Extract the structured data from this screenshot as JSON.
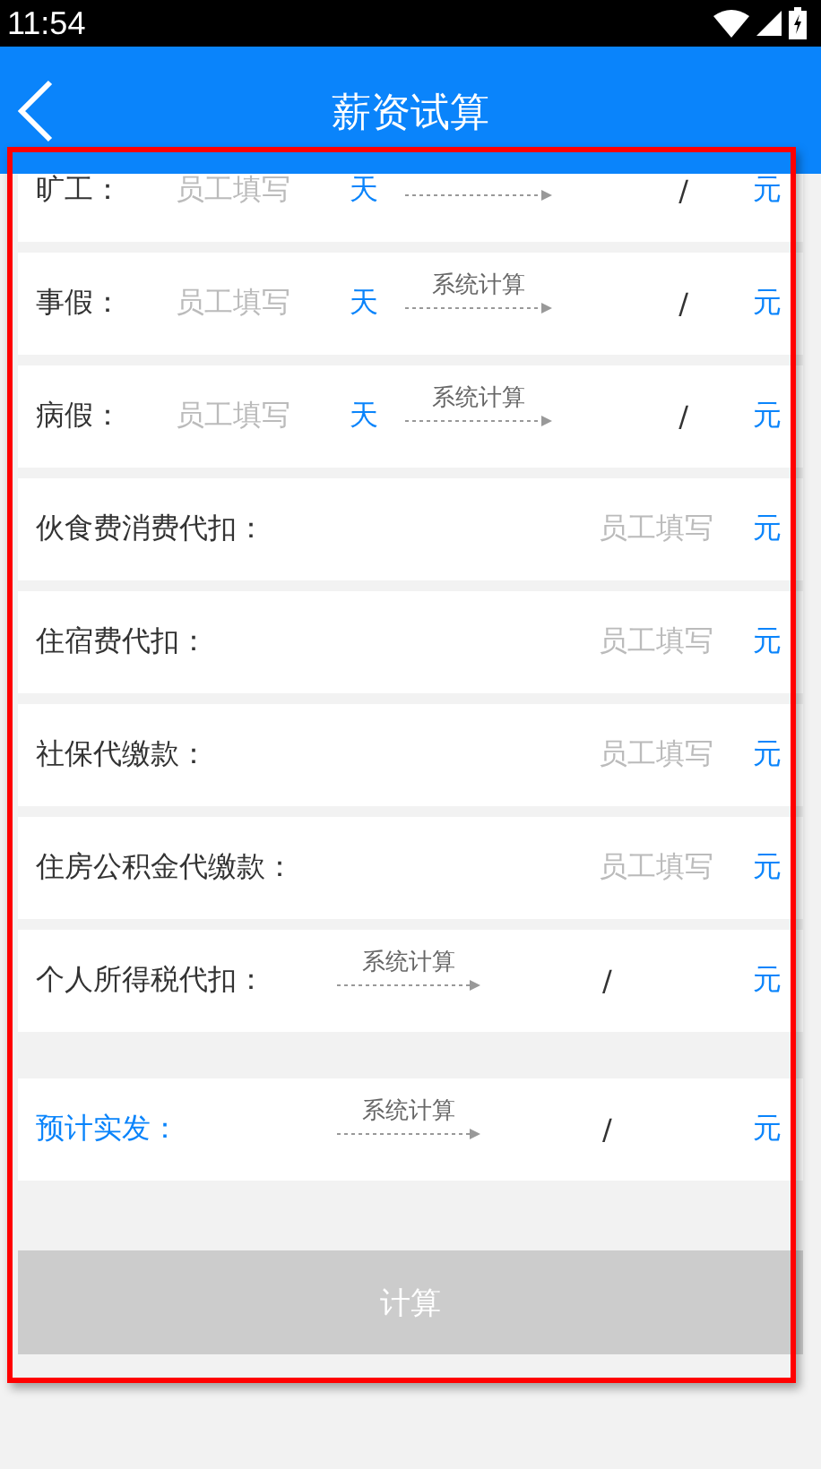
{
  "status_bar": {
    "time": "11:54"
  },
  "app_bar": {
    "title": "薪资试算"
  },
  "rows": [
    {
      "kind": "days",
      "label": "旷工：",
      "placeholder": "员工填写",
      "unit": "天",
      "value": "/",
      "currency": "元"
    },
    {
      "kind": "days",
      "label": "事假：",
      "placeholder": "员工填写",
      "unit": "天",
      "calc_label": "系统计算",
      "value": "/",
      "currency": "元"
    },
    {
      "kind": "days",
      "label": "病假：",
      "placeholder": "员工填写",
      "unit": "天",
      "calc_label": "系统计算",
      "value": "/",
      "currency": "元"
    },
    {
      "kind": "amount",
      "label": "伙食费消费代扣：",
      "placeholder": "员工填写",
      "currency": "元"
    },
    {
      "kind": "amount",
      "label": "住宿费代扣：",
      "placeholder": "员工填写",
      "currency": "元"
    },
    {
      "kind": "amount",
      "label": "社保代缴款：",
      "placeholder": "员工填写",
      "currency": "元"
    },
    {
      "kind": "amount",
      "label": "住房公积金代缴款：",
      "placeholder": "员工填写",
      "currency": "元"
    },
    {
      "kind": "computed",
      "label": "个人所得税代扣：",
      "calc_label": "系统计算",
      "value": "/",
      "currency": "元"
    }
  ],
  "summary": {
    "kind": "computed",
    "label": "预计实发：",
    "calc_label": "系统计算",
    "value": "/",
    "currency": "元"
  },
  "button": {
    "label": "计算",
    "disabled": true
  },
  "annotation": {
    "kind": "highlight"
  }
}
